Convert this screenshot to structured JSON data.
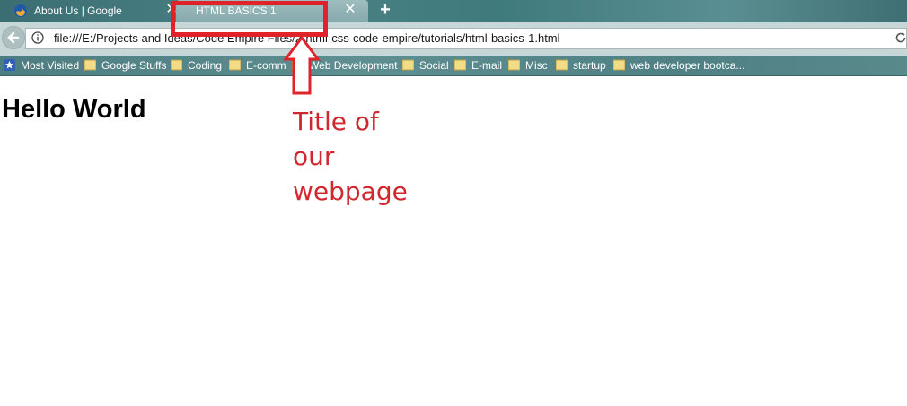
{
  "tabs": [
    {
      "title": "About Us | Google",
      "favicon": "firefox-icon",
      "active": false
    },
    {
      "title": "HTML BASICS 1",
      "active": true
    }
  ],
  "tab_close_glyph": "✕",
  "new_tab_glyph": "+",
  "address_bar": {
    "url": "file:///E:/Projects and Ideas/Code Empire Files/2-html-css-code-empire/tutorials/html-basics-1.html"
  },
  "bookmarks": [
    {
      "label": "Most Visited",
      "icon": "bookmark-star-icon"
    },
    {
      "label": "Google Stuffs",
      "icon": "folder-icon"
    },
    {
      "label": "Coding",
      "icon": "folder-icon"
    },
    {
      "label": "E-comm",
      "icon": "folder-icon"
    },
    {
      "label": "Web Development",
      "icon": "folder-icon"
    },
    {
      "label": "Social",
      "icon": "folder-icon"
    },
    {
      "label": "E-mail",
      "icon": "folder-icon"
    },
    {
      "label": "Misc",
      "icon": "folder-icon"
    },
    {
      "label": "startup",
      "icon": "folder-icon"
    },
    {
      "label": "web developer bootca...",
      "icon": "folder-icon"
    }
  ],
  "page": {
    "heading": "Hello World"
  },
  "annotation": {
    "lines": [
      "Title of",
      "our",
      "webpage"
    ],
    "color": "#e0232a"
  }
}
